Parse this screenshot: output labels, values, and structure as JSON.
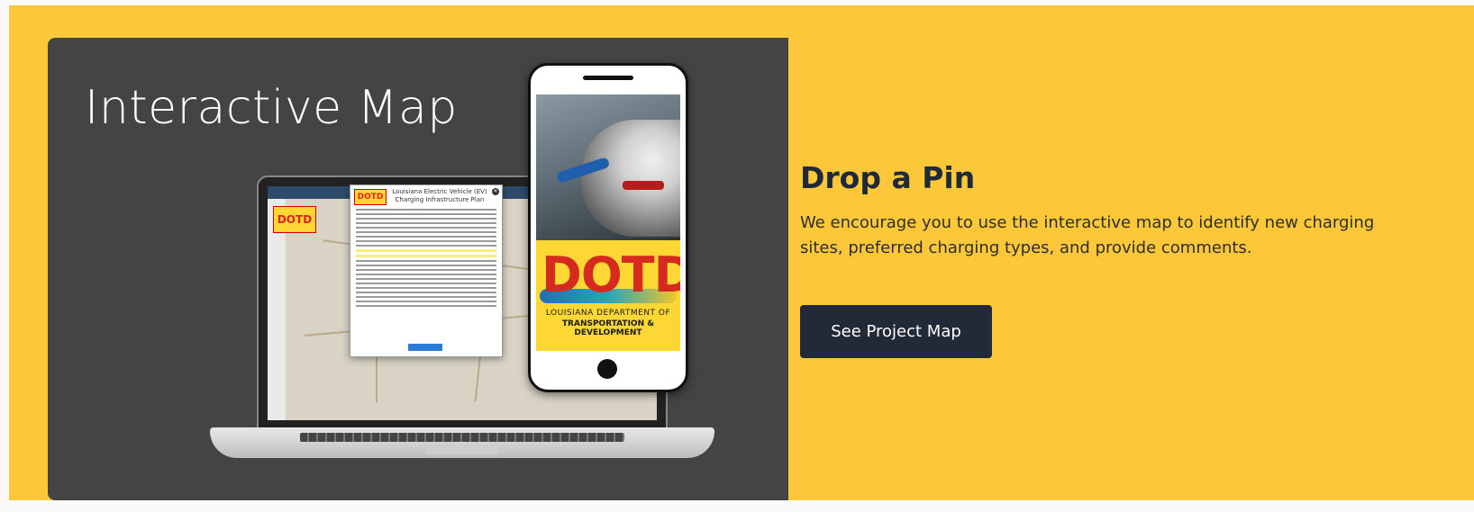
{
  "panel": {
    "title": "Interactive Map"
  },
  "laptop": {
    "map_logo": "DOTD",
    "modal_logo": "DOTD",
    "modal_title": "Louisiana Electric Vehicle (EV) Charging Infrastructure Plan"
  },
  "phone": {
    "logo": "DOTD",
    "agency_line1": "LOUISIANA DEPARTMENT OF",
    "agency_line2": "TRANSPORTATION & DEVELOPMENT"
  },
  "content": {
    "heading": "Drop a Pin",
    "description": "We encourage you to use the interactive map to identify new charging sites, preferred charging types, and provide comments.",
    "button_label": "See Project Map"
  },
  "colors": {
    "background": "#fdc73a",
    "panel": "#444444",
    "button": "#232a37",
    "heading": "#1f2937"
  }
}
